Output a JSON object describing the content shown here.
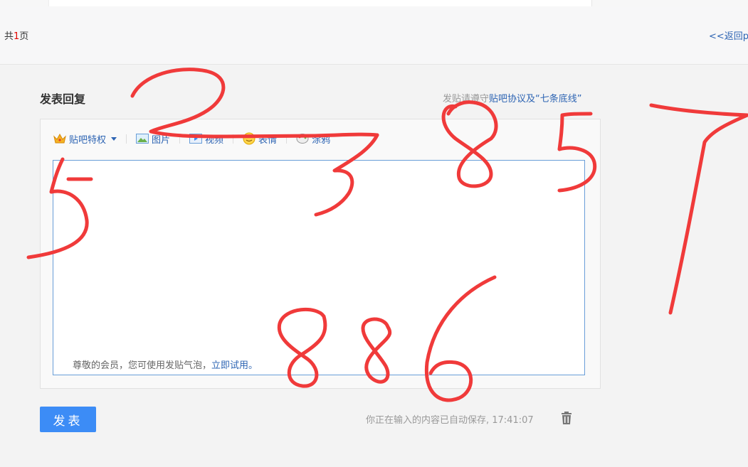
{
  "pager": {
    "prefix": "共",
    "page_count": "1",
    "suffix": "页",
    "back_link": "<<返回p"
  },
  "reply": {
    "title": "发表回复",
    "rules_prefix": "发贴请遵守",
    "rules_link": "贴吧协议及“七条底线”"
  },
  "toolbar": {
    "privilege": "贴吧特权",
    "image": "图片",
    "video": "视频",
    "emoji": "表情",
    "graffiti": "涂鸦"
  },
  "editor": {
    "bubble_text": "尊敬的会员，您可使用发贴气泡，",
    "bubble_link": "立即试用。"
  },
  "submit_label": "发表",
  "autosave_text": "你正在输入的内容已自动保存, 17:41:07",
  "handwriting": [
    "2",
    "3",
    "8",
    "5",
    "7",
    "5",
    "8",
    "8",
    "6"
  ],
  "colors": {
    "accent": "#3c8cf6",
    "link": "#2d64b3",
    "ink": "#f03a3a"
  }
}
